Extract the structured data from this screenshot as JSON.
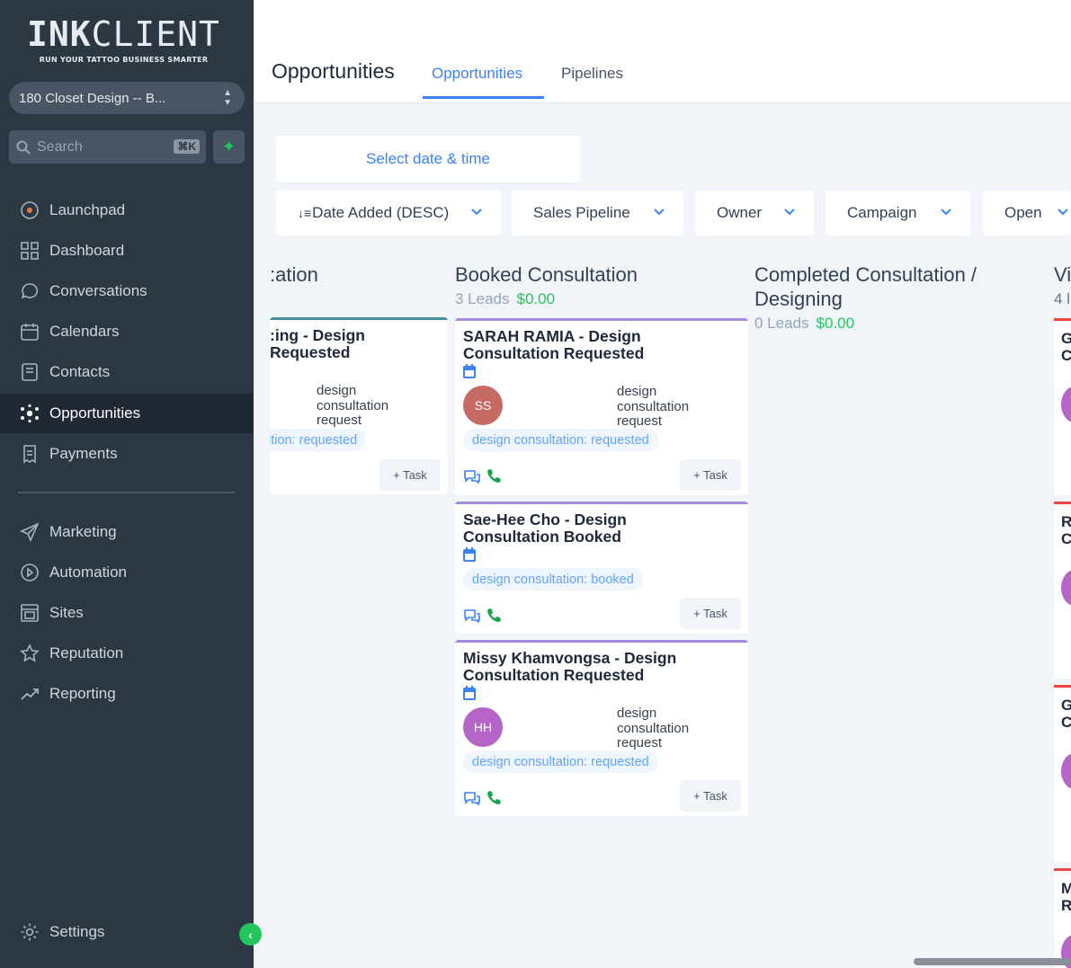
{
  "brand": {
    "name_bold": "INK",
    "name_light": "CLIENT",
    "tagline": "RUN YOUR TATTOO BUSINESS SMARTER"
  },
  "account": {
    "name": "180 Closet Design -- B..."
  },
  "search": {
    "placeholder": "Search",
    "shortcut": "⌘K"
  },
  "nav": {
    "primary": [
      {
        "label": "Launchpad",
        "icon": "rocket-icon"
      },
      {
        "label": "Dashboard",
        "icon": "dashboard-grid-icon"
      },
      {
        "label": "Conversations",
        "icon": "chat-bubble-icon"
      },
      {
        "label": "Calendars",
        "icon": "calendar-icon"
      },
      {
        "label": "Contacts",
        "icon": "contact-book-icon"
      },
      {
        "label": "Opportunities",
        "icon": "network-icon",
        "active": true
      },
      {
        "label": "Payments",
        "icon": "receipt-icon"
      }
    ],
    "secondary": [
      {
        "label": "Marketing",
        "icon": "paper-plane-icon"
      },
      {
        "label": "Automation",
        "icon": "automation-icon"
      },
      {
        "label": "Sites",
        "icon": "browser-window-icon"
      },
      {
        "label": "Reputation",
        "icon": "star-icon"
      },
      {
        "label": "Reporting",
        "icon": "trend-chart-icon"
      }
    ],
    "settings": "Settings"
  },
  "header": {
    "title": "Opportunities",
    "tabs": [
      {
        "label": "Opportunities",
        "active": true
      },
      {
        "label": "Pipelines",
        "active": false
      }
    ]
  },
  "filters": {
    "date_button": "Select date & time",
    "sort": "Date Added (DESC)",
    "pipeline": "Sales Pipeline",
    "owner": "Owner",
    "campaign": "Campaign",
    "status": "Open"
  },
  "columns": [
    {
      "title_fragment": ":ation",
      "cards": [
        {
          "title_line1": ":ing - Design",
          "title_line2": "Requested",
          "source": [
            "design",
            "consultation",
            "request"
          ],
          "tag": "ition: requested",
          "task": "+ Task"
        }
      ]
    },
    {
      "title": "Booked Consultation",
      "leads": "3 Leads",
      "amount": "$0.00",
      "cards": [
        {
          "title_line1": "SARAH RAMIA - Design",
          "title_line2": "Consultation Requested",
          "initials": "SS",
          "source": [
            "design",
            "consultation",
            "request"
          ],
          "tag": "design consultation: requested",
          "task": "+ Task"
        },
        {
          "title_line1": "Sae-Hee Cho - Design",
          "title_line2": "Consultation Booked",
          "tag": "design consultation: booked",
          "task": "+ Task"
        },
        {
          "title_line1": "Missy Khamvongsa - Design",
          "title_line2": "Consultation Requested",
          "initials": "HH",
          "source": [
            "design",
            "consultation",
            "request"
          ],
          "tag": "design consultation: requested",
          "task": "+ Task"
        }
      ]
    },
    {
      "title_line1": "Completed Consultation /",
      "title_line2": "Designing",
      "leads": "0 Leads",
      "amount": "$0.00"
    },
    {
      "title_fragment": "Vi",
      "leads_fragment": "4 l",
      "card_letters": [
        [
          "G",
          "C"
        ],
        [
          "R",
          "C"
        ],
        [
          "G",
          "C"
        ],
        [
          "M",
          "R"
        ]
      ]
    }
  ],
  "colors": {
    "sidebar": "#2c3744",
    "accent": "#3b82f6",
    "money": "#22c55e",
    "stage_bar_purple": "#a78bda",
    "stage_bar_teal": "#4b8f98",
    "stage_bar_red": "#ef4444"
  }
}
